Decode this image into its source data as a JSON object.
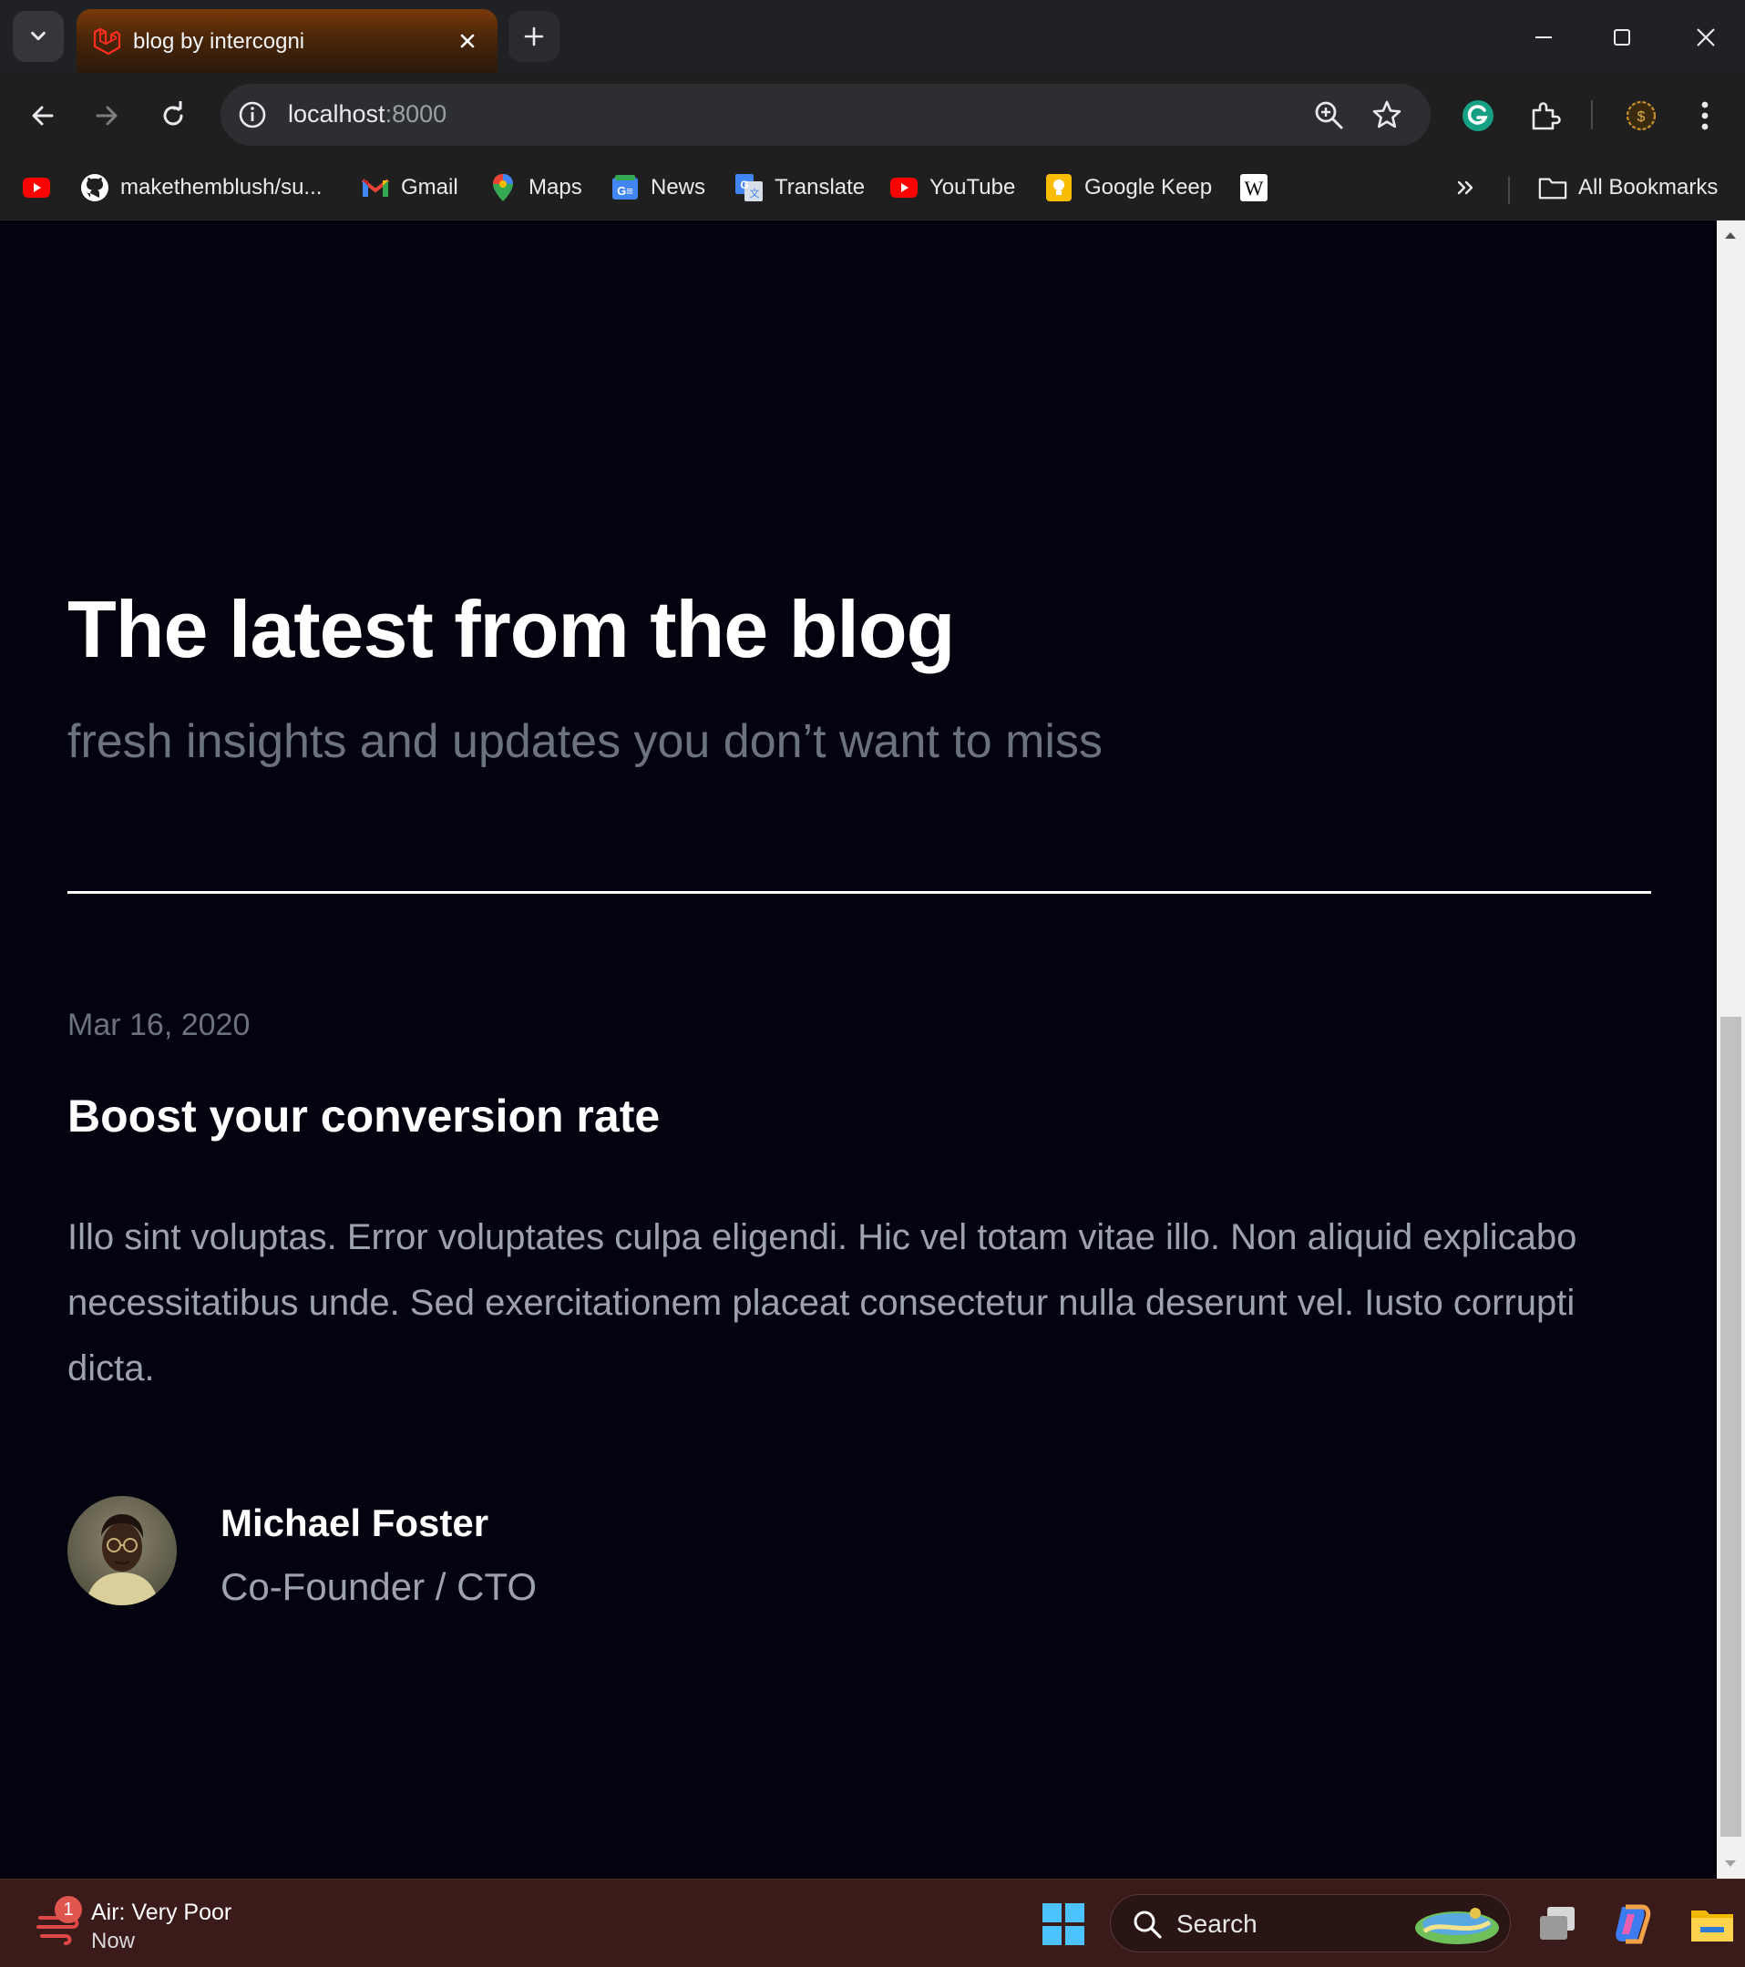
{
  "browser": {
    "tab_title": "blog by intercogni",
    "url_host": "localhost",
    "url_port": ":8000",
    "bookmarks": [
      {
        "label": ""
      },
      {
        "label": "makethemblush/su..."
      },
      {
        "label": "Gmail"
      },
      {
        "label": "Maps"
      },
      {
        "label": "News"
      },
      {
        "label": "Translate"
      },
      {
        "label": "YouTube"
      },
      {
        "label": "Google Keep"
      },
      {
        "label": ""
      }
    ],
    "all_bookmarks_label": "All Bookmarks"
  },
  "page": {
    "headline": "The latest from the blog",
    "subheadline": "fresh insights and updates you don’t want to miss",
    "post": {
      "date": "Mar 16, 2020",
      "title": "Boost your conversion rate",
      "excerpt": "Illo sint voluptas. Error voluptates culpa eligendi. Hic vel totam vitae illo. Non aliquid explicabo necessitatibus unde. Sed exercitationem placeat consectetur nulla deserunt vel. Iusto corrupti dicta.",
      "author_name": "Michael Foster",
      "author_role": "Co-Founder / CTO"
    }
  },
  "taskbar": {
    "weather_title": "Air: Very Poor",
    "weather_sub": "Now",
    "weather_badge": "1",
    "search_label": "Search"
  },
  "colors": {
    "page_bg": "#02030f",
    "heading": "#ffffff",
    "muted": "#6b7280",
    "body_text": "#9ca3af",
    "tab_accent": "#7a3a0a",
    "taskbar_bg": "#3b1a1a"
  }
}
